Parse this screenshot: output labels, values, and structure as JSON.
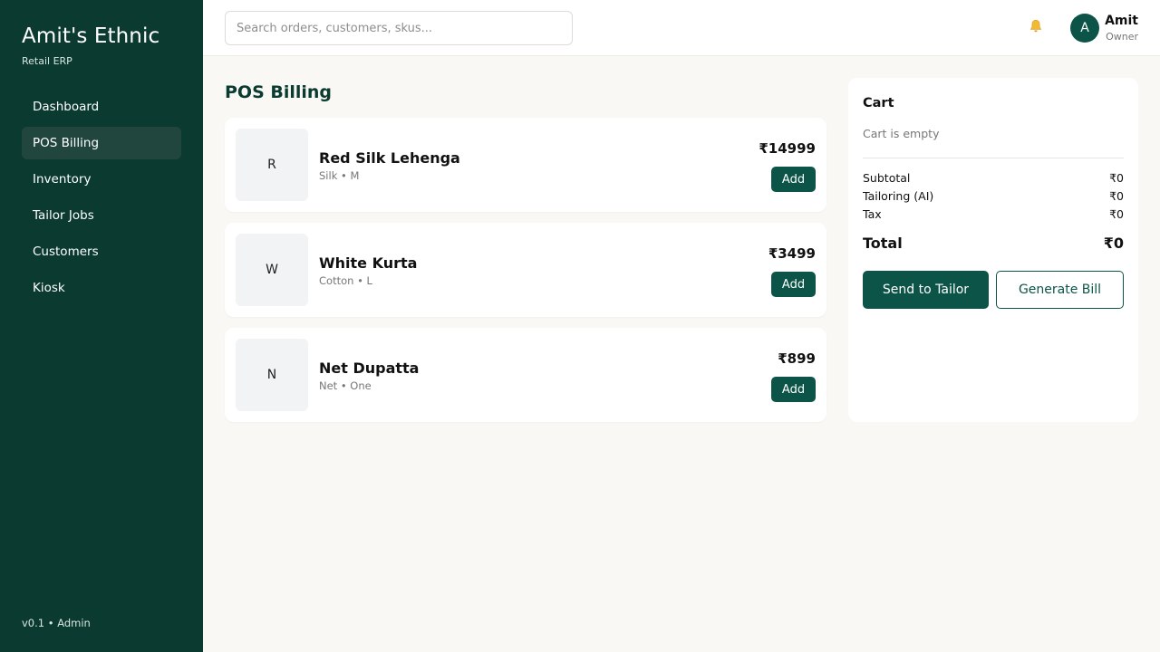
{
  "sidebar": {
    "brand": "Amit's Ethnic",
    "subtitle": "Retail ERP",
    "items": [
      {
        "label": "Dashboard"
      },
      {
        "label": "POS Billing"
      },
      {
        "label": "Inventory"
      },
      {
        "label": "Tailor Jobs"
      },
      {
        "label": "Customers"
      },
      {
        "label": "Kiosk"
      }
    ],
    "active_item": "POS Billing",
    "footer": "v0.1 • Admin"
  },
  "topbar": {
    "search_placeholder": "Search orders, customers, skus...",
    "notification_icon": "bell-icon",
    "user": {
      "initial": "A",
      "name": "Amit",
      "role": "Owner"
    }
  },
  "main": {
    "title": "POS Billing",
    "products": [
      {
        "initial": "R",
        "name": "Red Silk Lehenga",
        "meta": "Silk • M",
        "price": "₹14999",
        "add_label": "Add"
      },
      {
        "initial": "W",
        "name": "White Kurta",
        "meta": "Cotton • L",
        "price": "₹3499",
        "add_label": "Add"
      },
      {
        "initial": "N",
        "name": "Net Dupatta",
        "meta": "Net • One",
        "price": "₹899",
        "add_label": "Add"
      }
    ]
  },
  "cart": {
    "title": "Cart",
    "empty_text": "Cart is empty",
    "subtotal_label": "Subtotal",
    "subtotal_value": "₹0",
    "tailoring_label": "Tailoring (AI)",
    "tailoring_value": "₹0",
    "tax_label": "Tax",
    "tax_value": "₹0",
    "total_label": "Total",
    "total_value": "₹0",
    "send_to_tailor_label": "Send to Tailor",
    "generate_bill_label": "Generate Bill"
  },
  "colors": {
    "sidebar_bg": "#0a3a30",
    "accent": "#0b5447",
    "page_bg": "#f9f8f5"
  }
}
